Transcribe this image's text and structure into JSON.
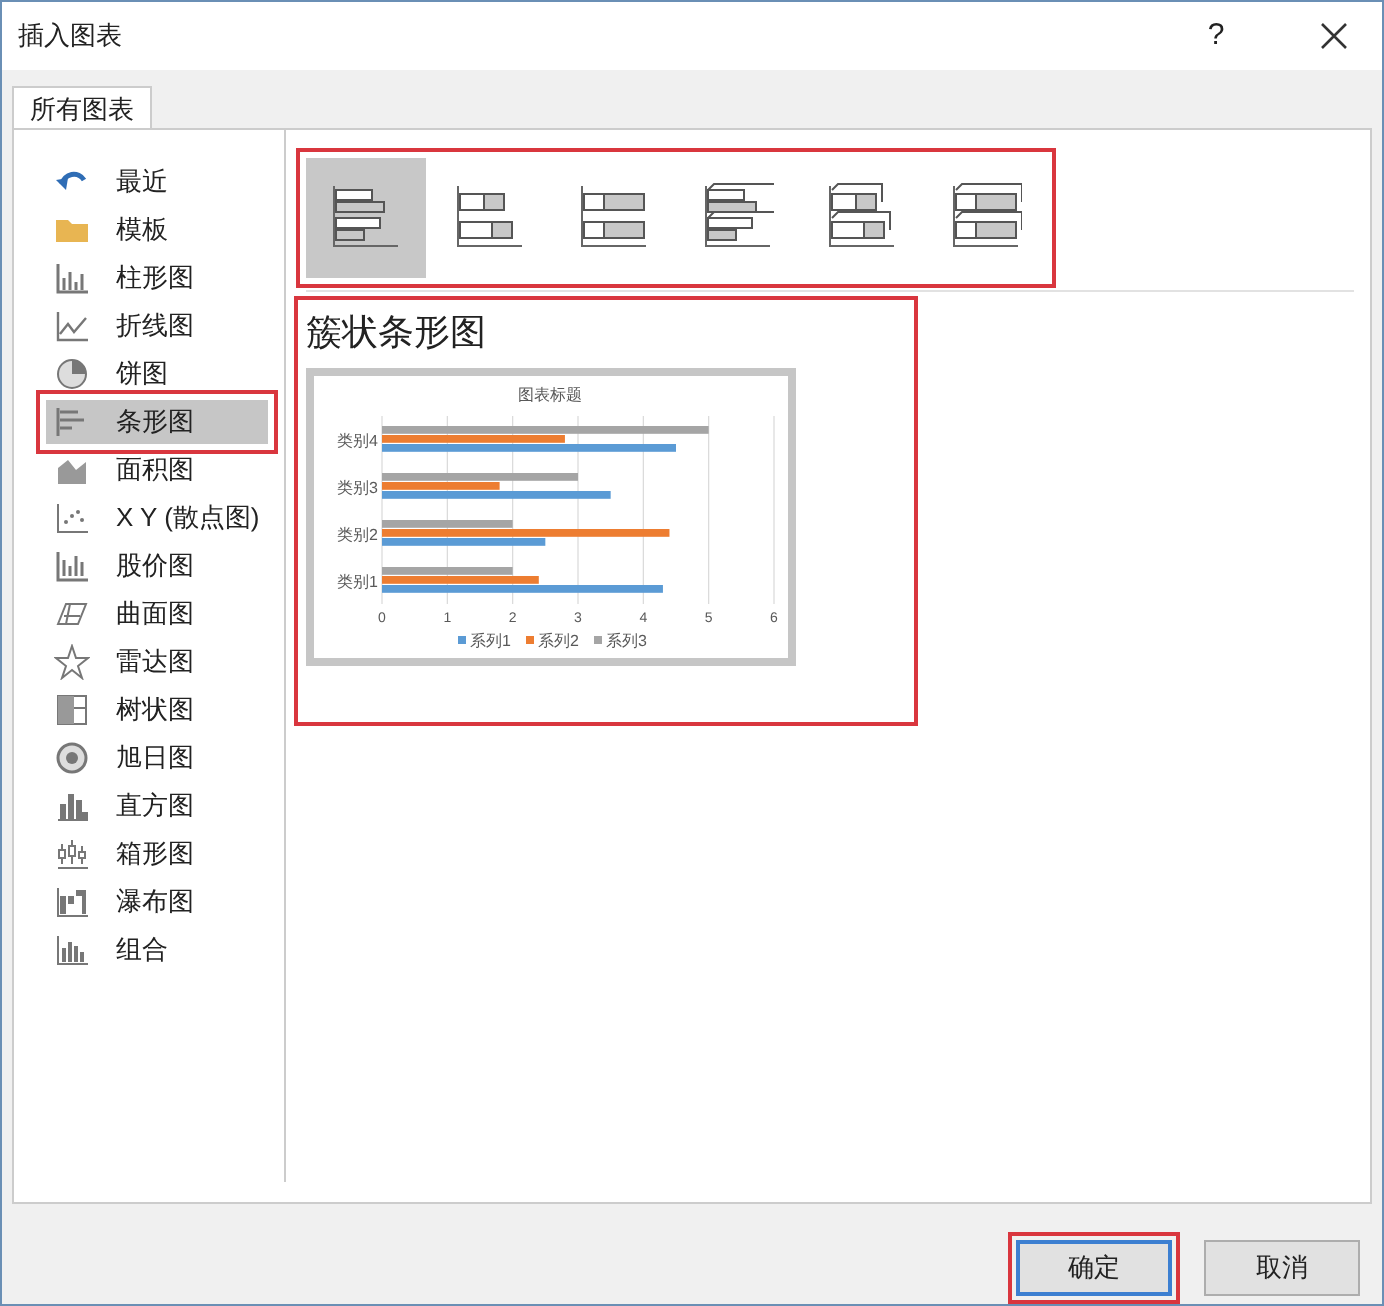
{
  "window": {
    "title": "插入图表",
    "help": "?"
  },
  "tabs": [
    {
      "label": "所有图表",
      "selected": true
    }
  ],
  "sidebar": {
    "items": [
      {
        "label": "最近",
        "selected": false,
        "annotated": false
      },
      {
        "label": "模板",
        "selected": false,
        "annotated": false
      },
      {
        "label": "柱形图",
        "selected": false,
        "annotated": false
      },
      {
        "label": "折线图",
        "selected": false,
        "annotated": false
      },
      {
        "label": "饼图",
        "selected": false,
        "annotated": false
      },
      {
        "label": "条形图",
        "selected": true,
        "annotated": true
      },
      {
        "label": "面积图",
        "selected": false,
        "annotated": false
      },
      {
        "label": "X Y (散点图)",
        "selected": false,
        "annotated": false
      },
      {
        "label": "股价图",
        "selected": false,
        "annotated": false
      },
      {
        "label": "曲面图",
        "selected": false,
        "annotated": false
      },
      {
        "label": "雷达图",
        "selected": false,
        "annotated": false
      },
      {
        "label": "树状图",
        "selected": false,
        "annotated": false
      },
      {
        "label": "旭日图",
        "selected": false,
        "annotated": false
      },
      {
        "label": "直方图",
        "selected": false,
        "annotated": false
      },
      {
        "label": "箱形图",
        "selected": false,
        "annotated": false
      },
      {
        "label": "瀑布图",
        "selected": false,
        "annotated": false
      },
      {
        "label": "组合",
        "selected": false,
        "annotated": false
      }
    ]
  },
  "subtypes": {
    "annotated": true,
    "items": [
      {
        "selected": true
      },
      {
        "selected": false
      },
      {
        "selected": false
      },
      {
        "selected": false
      },
      {
        "selected": false
      },
      {
        "selected": false
      }
    ]
  },
  "preview": {
    "title": "簇状条形图",
    "annotated": true,
    "chart_data": {
      "type": "bar",
      "orientation": "horizontal",
      "title": "图表标题",
      "categories": [
        "类别4",
        "类别3",
        "类别2",
        "类别1"
      ],
      "series": [
        {
          "name": "系列1",
          "color": "#5b9bd5",
          "values": [
            4.5,
            3.5,
            2.5,
            4.3
          ]
        },
        {
          "name": "系列2",
          "color": "#ed7d31",
          "values": [
            2.8,
            1.8,
            4.4,
            2.4
          ]
        },
        {
          "name": "系列3",
          "color": "#a5a5a5",
          "values": [
            5,
            3,
            2,
            2
          ]
        }
      ],
      "xlim": [
        0,
        6
      ],
      "xticks": [
        0,
        1,
        2,
        3,
        4,
        5,
        6
      ],
      "grid": true,
      "legend": "bottom"
    }
  },
  "buttons": [
    {
      "label": "确定",
      "focused": true,
      "annotated": true
    },
    {
      "label": "取消",
      "focused": false,
      "annotated": false
    }
  ]
}
